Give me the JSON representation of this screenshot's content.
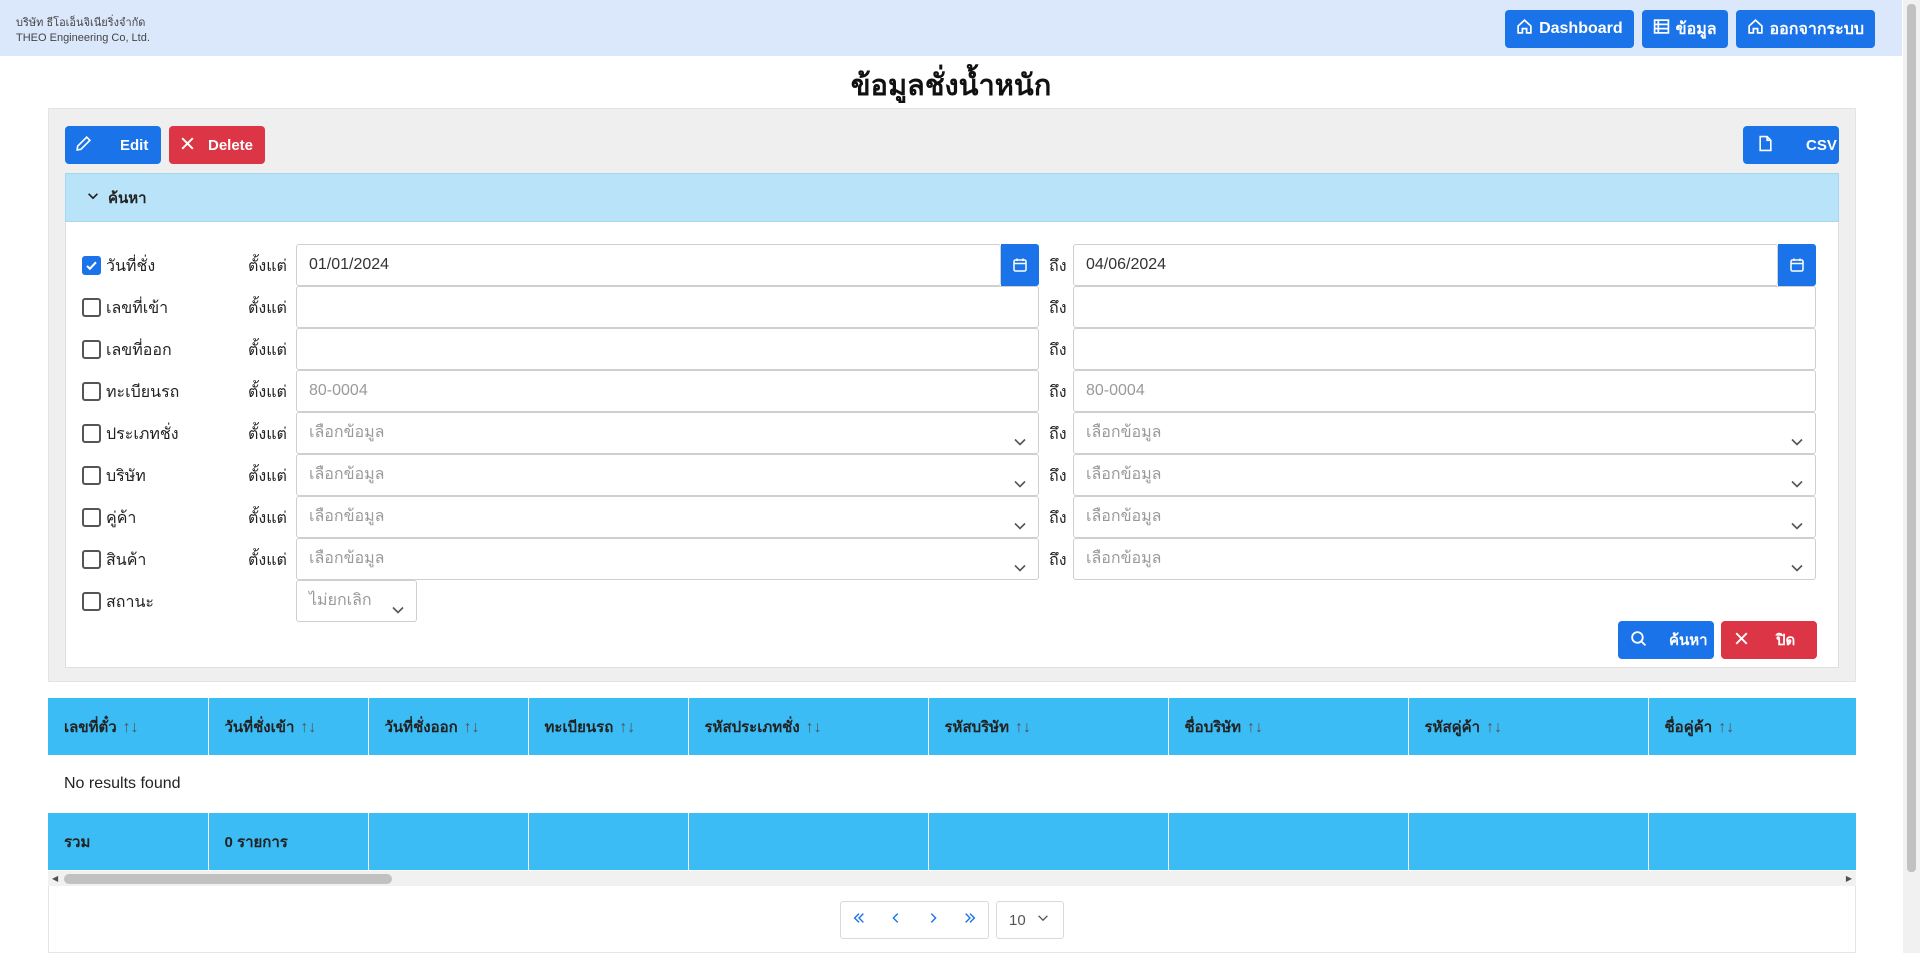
{
  "company": {
    "name_th": "บริษัท ธีโอเอ็นจิเนียริ่งจำกัด",
    "name_en": "THEO Engineering Co, Ltd."
  },
  "nav": {
    "dashboard": "Dashboard",
    "data": "ข้อมูล",
    "logout": "ออกจากระบบ"
  },
  "page": {
    "title": "ข้อมูลชั่งน้ำหนัก"
  },
  "toolbar": {
    "edit": "Edit",
    "delete": "Delete",
    "csv": "CSV"
  },
  "search": {
    "header": "ค้นหา",
    "from_label": "ตั้งแต่",
    "to_label": "ถึง",
    "fields": [
      {
        "label": "วันที่ชั่ง",
        "checked": true,
        "from": "01/01/2024",
        "to": "04/06/2024"
      },
      {
        "label": "เลขที่เข้า",
        "checked": false,
        "from": "",
        "to": ""
      },
      {
        "label": "เลขที่ออก",
        "checked": false,
        "from": "",
        "to": ""
      },
      {
        "label": "ทะเบียนรถ",
        "checked": false,
        "from_placeholder": "80-0004",
        "to_placeholder": "80-0004"
      },
      {
        "label": "ประเภทชั่ง",
        "checked": false,
        "from_placeholder": "เลือกข้อมูล",
        "to_placeholder": "เลือกข้อมูล"
      },
      {
        "label": "บริษัท",
        "checked": false,
        "from_placeholder": "เลือกข้อมูล",
        "to_placeholder": "เลือกข้อมูล"
      },
      {
        "label": "คู่ค้า",
        "checked": false,
        "from_placeholder": "เลือกข้อมูล",
        "to_placeholder": "เลือกข้อมูล"
      },
      {
        "label": "สินค้า",
        "checked": false,
        "from_placeholder": "เลือกข้อมูล",
        "to_placeholder": "เลือกข้อมูล"
      }
    ],
    "status": {
      "label": "สถานะ",
      "checked": false,
      "value": "ไม่ยกเลิก"
    },
    "search_button": "ค้นหา",
    "close_button": "ปิด"
  },
  "table": {
    "columns": [
      "เลขที่ตั๋ว",
      "วันที่ชั่งเข้า",
      "วันที่ชั่งออก",
      "ทะเบียนรถ",
      "รหัสประเภทชั่ง",
      "รหัสบริษัท",
      "ชื่อบริษัท",
      "รหัสคู่ค้า",
      "ชื่อคู่ค้า"
    ],
    "empty_message": "No results found",
    "footer_label": "รวม",
    "footer_count": "0 รายการ"
  },
  "pagination": {
    "page_size": "10"
  },
  "colors": {
    "primary": "#1a73e8",
    "danger": "#dc3545",
    "table_header": "#3bbcf5",
    "search_header": "#b9e3f8",
    "topbar": "#dbe8fb"
  }
}
